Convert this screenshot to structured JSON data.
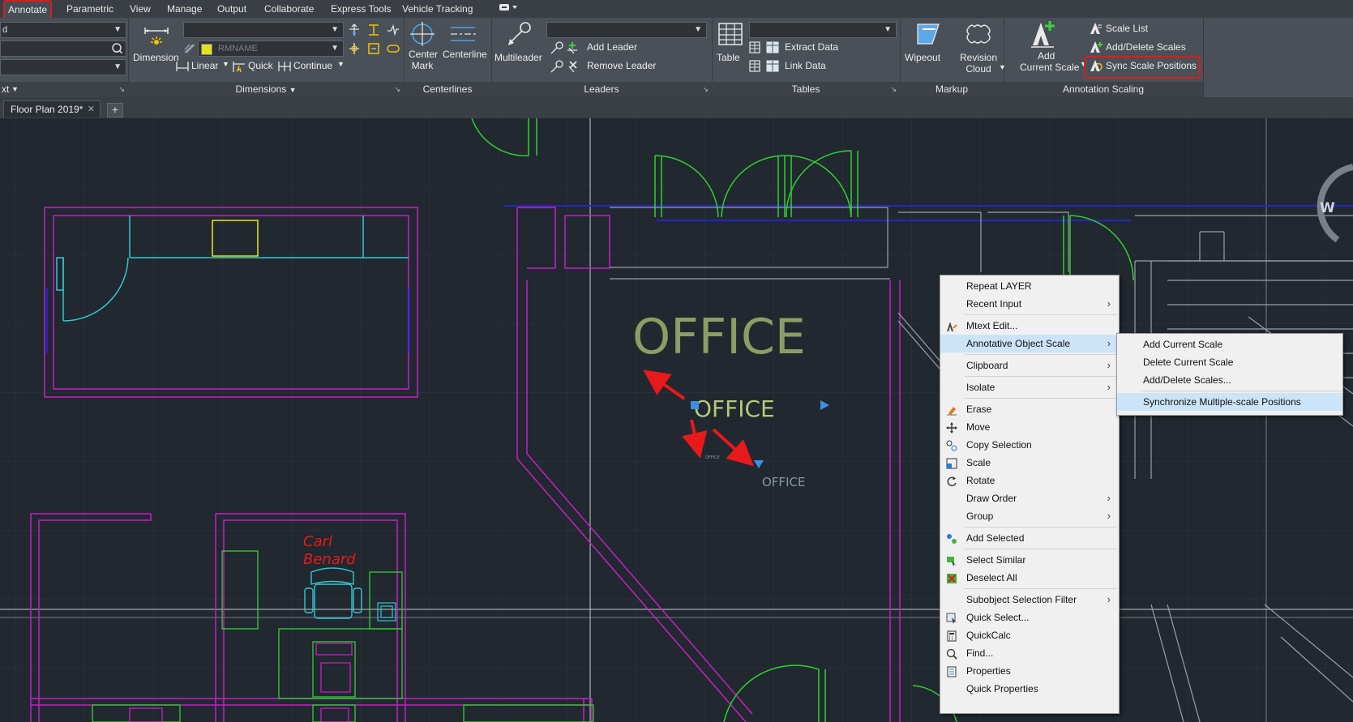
{
  "ribbon_tabs": [
    {
      "label": "Annotate",
      "active": true
    },
    {
      "label": "Parametric"
    },
    {
      "label": "View"
    },
    {
      "label": "Manage"
    },
    {
      "label": "Output"
    },
    {
      "label": "Collaborate"
    },
    {
      "label": "Express Tools"
    },
    {
      "label": "Vehicle Tracking"
    }
  ],
  "ribbon": {
    "text_panel": {
      "title": "xt",
      "combo1_value": "d"
    },
    "dimensions": {
      "title": "Dimensions",
      "dimension_label": "Dimension",
      "style_value": "RMNAME",
      "linear_label": "Linear",
      "quick_label": "Quick",
      "continue_label": "Continue"
    },
    "centerlines": {
      "title": "Centerlines",
      "center_mark_label": "Center\nMark",
      "center_mark_l1": "Center",
      "center_mark_l2": "Mark",
      "centerline_label": "Centerline"
    },
    "leaders": {
      "title": "Leaders",
      "multileader_label": "Multileader",
      "add_leader_label": "Add Leader",
      "remove_leader_label": "Remove Leader"
    },
    "tables": {
      "title": "Tables",
      "table_label": "Table",
      "extract_data_label": "Extract Data",
      "link_data_label": "Link Data"
    },
    "markup": {
      "title": "Markup",
      "wipeout_label": "Wipeout",
      "revision_l1": "Revision",
      "revision_l2": "Cloud"
    },
    "annotation_scaling": {
      "title": "Annotation Scaling",
      "add_l1": "Add",
      "add_l2": "Current Scale",
      "scale_list_label": "Scale List",
      "add_delete_label": "Add/Delete Scales",
      "sync_label": "Sync Scale Positions"
    }
  },
  "file_tab": {
    "label": "Floor Plan 2019*",
    "close": "✕",
    "new": "+"
  },
  "drawing": {
    "office_large": "OFFICE",
    "office_medium": "OFFICE",
    "office_small": "OFFICE",
    "office_tiny": "OFFICE",
    "person_line1": "Carl",
    "person_line2": "Benard",
    "viewcube_letter": "W"
  },
  "context_menu": {
    "items": [
      {
        "label": "Repeat LAYER"
      },
      {
        "label": "Recent Input",
        "sub": "›"
      },
      {
        "label": "Mtext Edit..."
      },
      {
        "label": "Annotative Object Scale",
        "sub": "›"
      },
      {
        "label": "Clipboard",
        "sub": "›"
      },
      {
        "label": "Isolate",
        "sub": "›"
      },
      {
        "label": "Erase"
      },
      {
        "label": "Move"
      },
      {
        "label": "Copy Selection"
      },
      {
        "label": "Scale"
      },
      {
        "label": "Rotate"
      },
      {
        "label": "Draw Order",
        "sub": "›"
      },
      {
        "label": "Group",
        "sub": "›"
      },
      {
        "label": "Add Selected"
      },
      {
        "label": "Select Similar"
      },
      {
        "label": "Deselect All"
      },
      {
        "label": "Subobject Selection Filter",
        "sub": "›"
      },
      {
        "label": "Quick Select..."
      },
      {
        "label": "QuickCalc"
      },
      {
        "label": "Find..."
      },
      {
        "label": "Properties"
      },
      {
        "label": "Quick Properties"
      }
    ]
  },
  "submenu": {
    "items": [
      {
        "label": "Add Current Scale"
      },
      {
        "label": "Delete Current Scale"
      },
      {
        "label": "Add/Delete Scales..."
      },
      {
        "label": "Synchronize Multiple-scale Positions"
      }
    ]
  },
  "colors": {
    "highlight_red": "#d81e1e",
    "menu_hover": "#cce4f7",
    "magenta": "#c51fc5",
    "green": "#2fd12f",
    "cyan": "#35c7d0",
    "blue": "#2424c8"
  }
}
